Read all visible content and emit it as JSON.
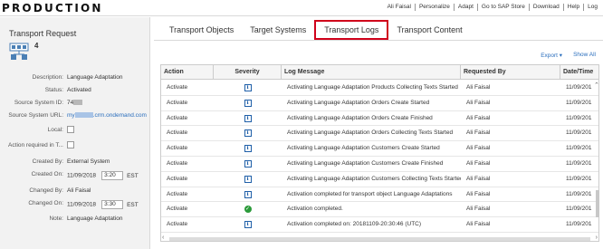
{
  "app": {
    "brand": "PRODUCTION",
    "top_links": [
      "Ali Faisal",
      "Personalize",
      "Adapt",
      "Go to SAP Store",
      "Download",
      "Help",
      "Log"
    ]
  },
  "left": {
    "title": "Transport Request",
    "count": "4",
    "fields": {
      "description_label": "Description:",
      "description_value": "Language Adaptation",
      "status_label": "Status:",
      "status_value": "Activated",
      "source_id_label": "Source System ID:",
      "source_id_value": "74",
      "source_url_label": "Source System URL:",
      "source_url_prefix": "my",
      "source_url_suffix": ".crm.ondemand.com",
      "local_label": "Local:",
      "action_required_label": "Action required in T...",
      "created_by_label": "Created By:",
      "created_by_value": "External System",
      "created_on_label": "Created On:",
      "created_on_date": "11/09/2018",
      "created_on_time": "3:20",
      "created_on_tz": "EST",
      "changed_by_label": "Changed By:",
      "changed_by_value": "Ali Faisal",
      "changed_on_label": "Changed On:",
      "changed_on_date": "11/09/2018",
      "changed_on_time": "3:30",
      "changed_on_tz": "EST",
      "note_label": "Note:",
      "note_value": "Language Adaptation"
    }
  },
  "tabs": [
    "Transport Objects",
    "Target Systems",
    "Transport Logs",
    "Transport Content"
  ],
  "table_actions": {
    "export": "Export",
    "export_caret": "▾",
    "show_all": "Show All"
  },
  "table": {
    "headers": [
      "Action",
      "Severity",
      "Log Message",
      "Requested By",
      "Date/Time"
    ],
    "rows": [
      {
        "action": "Activate",
        "severity": "info",
        "message": "Activating Language Adaptation Products Collecting Texts Started",
        "by": "Ali Faisal",
        "date": "11/09/201"
      },
      {
        "action": "Activate",
        "severity": "info",
        "message": "Activating Language Adaptation Orders Create Started",
        "by": "Ali Faisal",
        "date": "11/09/201"
      },
      {
        "action": "Activate",
        "severity": "info",
        "message": "Activating Language Adaptation Orders Create Finished",
        "by": "Ali Faisal",
        "date": "11/09/201"
      },
      {
        "action": "Activate",
        "severity": "info",
        "message": "Activating Language Adaptation Orders Collecting Texts Started",
        "by": "Ali Faisal",
        "date": "11/09/201"
      },
      {
        "action": "Activate",
        "severity": "info",
        "message": "Activating Language Adaptation Customers Create Started",
        "by": "Ali Faisal",
        "date": "11/09/201"
      },
      {
        "action": "Activate",
        "severity": "info",
        "message": "Activating Language Adaptation Customers Create Finished",
        "by": "Ali Faisal",
        "date": "11/09/201"
      },
      {
        "action": "Activate",
        "severity": "info",
        "message": "Activating Language Adaptation Customers Collecting Texts Started",
        "by": "Ali Faisal",
        "date": "11/09/201"
      },
      {
        "action": "Activate",
        "severity": "info",
        "message": "Activation completed for transport object Language Adaptations",
        "by": "Ali Faisal",
        "date": "11/09/201"
      },
      {
        "action": "Activate",
        "severity": "success",
        "message": "Activation completed.",
        "by": "Ali Faisal",
        "date": "11/09/201"
      },
      {
        "action": "Activate",
        "severity": "info",
        "message": "Activation completed on: 20181109-20:30:46 (UTC)",
        "by": "Ali Faisal",
        "date": "11/09/201"
      }
    ]
  },
  "colors": {
    "accent": "#2a6ebd",
    "active_tab_border": "#d0021b",
    "info": "#1f5fa8",
    "success": "#2b9a3a"
  },
  "icons": {
    "info": "i",
    "success": "✓"
  }
}
